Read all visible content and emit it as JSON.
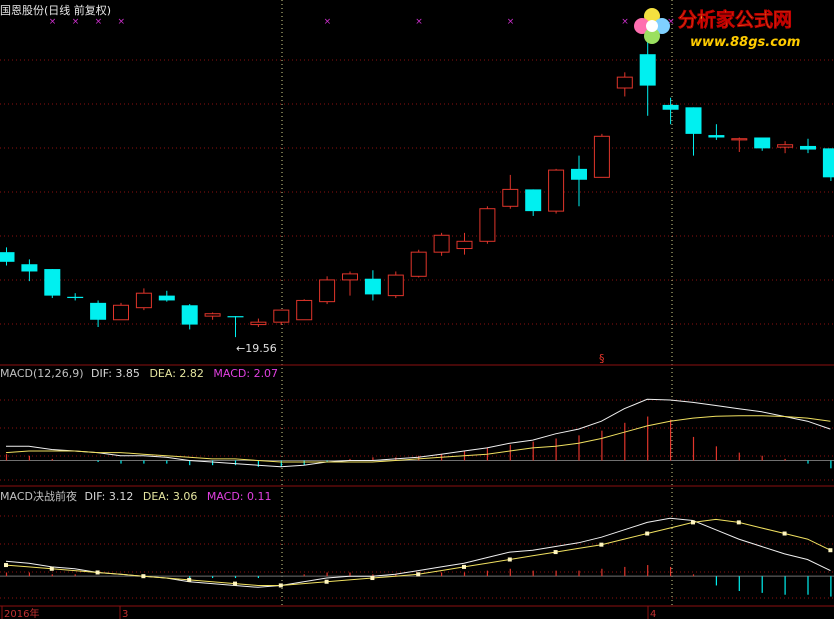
{
  "header": {
    "stock_title": "国恩股份(日线 前复权)"
  },
  "logo": {
    "text1": "分析家公式网",
    "text2": "www.88gs.com"
  },
  "colors": {
    "up": "#e0352b",
    "down": "#00f0f0",
    "dif_line": "#f0f0f0",
    "dea_line": "#f0e060",
    "macd_mag": "#e040e0",
    "grid_dot": "#8b1010",
    "divider": "#8b1010",
    "marker": "#d030d0"
  },
  "price_panel": {
    "low_label": "←19.56",
    "top_markers": [
      "×",
      "×",
      "×",
      "×",
      "×",
      "×",
      "×",
      "×",
      "×"
    ],
    "s_marker": "§"
  },
  "macd1": {
    "name": "MACD(12,26,9)",
    "dif_label": "DIF: 3.85",
    "dea_label": "DEA: 2.82",
    "macd_label": "MACD: 2.07"
  },
  "macd2": {
    "name": "MACD决战前夜",
    "dif_label": "DIF: 3.12",
    "dea_label": "DEA: 3.06",
    "macd_label": "MACD: 0.11"
  },
  "axis": {
    "date_labels": [
      "2016年",
      "3",
      "4"
    ]
  },
  "chart_data": [
    {
      "type": "candlestick",
      "title": "国恩股份(日线 前复权)",
      "candles": [
        {
          "o": 26.6,
          "h": 27.0,
          "l": 25.5,
          "c": 25.8
        },
        {
          "o": 25.6,
          "h": 26.0,
          "l": 24.2,
          "c": 25.0
        },
        {
          "o": 25.2,
          "h": 25.2,
          "l": 22.8,
          "c": 23.0
        },
        {
          "o": 22.9,
          "h": 23.2,
          "l": 22.6,
          "c": 22.8
        },
        {
          "o": 22.4,
          "h": 22.6,
          "l": 20.4,
          "c": 21.0
        },
        {
          "o": 21.0,
          "h": 22.4,
          "l": 21.0,
          "c": 22.2
        },
        {
          "o": 22.0,
          "h": 23.6,
          "l": 21.8,
          "c": 23.2
        },
        {
          "o": 23.0,
          "h": 23.4,
          "l": 22.5,
          "c": 22.6
        },
        {
          "o": 22.2,
          "h": 22.3,
          "l": 20.2,
          "c": 20.6
        },
        {
          "o": 21.3,
          "h": 21.6,
          "l": 21.0,
          "c": 21.5
        },
        {
          "o": 21.3,
          "h": 21.3,
          "l": 19.56,
          "c": 21.2
        },
        {
          "o": 20.6,
          "h": 21.1,
          "l": 20.4,
          "c": 20.8
        },
        {
          "o": 20.8,
          "h": 21.8,
          "l": 20.6,
          "c": 21.8
        },
        {
          "o": 21.0,
          "h": 22.7,
          "l": 21.0,
          "c": 22.6
        },
        {
          "o": 22.5,
          "h": 24.6,
          "l": 22.3,
          "c": 24.3
        },
        {
          "o": 24.3,
          "h": 25.0,
          "l": 23.0,
          "c": 24.8
        },
        {
          "o": 24.4,
          "h": 25.1,
          "l": 22.6,
          "c": 23.1
        },
        {
          "o": 23.0,
          "h": 25.0,
          "l": 22.8,
          "c": 24.7
        },
        {
          "o": 24.6,
          "h": 26.8,
          "l": 24.5,
          "c": 26.6
        },
        {
          "o": 26.6,
          "h": 28.2,
          "l": 26.3,
          "c": 28.0
        },
        {
          "o": 26.9,
          "h": 28.2,
          "l": 26.4,
          "c": 27.5
        },
        {
          "o": 27.5,
          "h": 30.4,
          "l": 27.3,
          "c": 30.2
        },
        {
          "o": 30.4,
          "h": 33.0,
          "l": 30.2,
          "c": 31.8
        },
        {
          "o": 31.8,
          "h": 31.8,
          "l": 29.6,
          "c": 30.0
        },
        {
          "o": 30.0,
          "h": 33.5,
          "l": 29.8,
          "c": 33.4
        },
        {
          "o": 33.5,
          "h": 34.6,
          "l": 30.4,
          "c": 32.6
        },
        {
          "o": 32.8,
          "h": 36.4,
          "l": 32.8,
          "c": 36.2
        },
        {
          "o": 40.2,
          "h": 41.5,
          "l": 39.5,
          "c": 41.1
        },
        {
          "o": 43.0,
          "h": 44.4,
          "l": 37.9,
          "c": 40.4
        },
        {
          "o": 38.8,
          "h": 39.4,
          "l": 37.2,
          "c": 38.4
        },
        {
          "o": 38.6,
          "h": 38.6,
          "l": 34.6,
          "c": 36.4
        },
        {
          "o": 36.3,
          "h": 37.2,
          "l": 35.9,
          "c": 36.1
        },
        {
          "o": 35.9,
          "h": 36.1,
          "l": 34.9,
          "c": 36.0
        },
        {
          "o": 36.1,
          "h": 36.1,
          "l": 35.0,
          "c": 35.2
        },
        {
          "o": 35.3,
          "h": 35.8,
          "l": 34.8,
          "c": 35.5
        },
        {
          "o": 35.4,
          "h": 36.0,
          "l": 34.8,
          "c": 35.1
        },
        {
          "o": 35.2,
          "h": 35.2,
          "l": 32.5,
          "c": 32.8
        }
      ],
      "ylim": [
        17.5,
        46.0
      ],
      "annotations": [
        "←19.56"
      ]
    },
    {
      "type": "line",
      "title": "MACD(12,26,9)",
      "series": [
        {
          "name": "DIF",
          "values": [
            0.9,
            0.9,
            0.7,
            0.6,
            0.5,
            0.3,
            0.3,
            0.2,
            0.0,
            -0.1,
            -0.2,
            -0.3,
            -0.4,
            -0.3,
            -0.1,
            0.0,
            0.0,
            0.1,
            0.2,
            0.4,
            0.6,
            0.8,
            1.1,
            1.3,
            1.7,
            2.0,
            2.5,
            3.3,
            3.9,
            3.85,
            3.7,
            3.5,
            3.3,
            3.1,
            2.8,
            2.5,
            2.0
          ]
        },
        {
          "name": "DEA",
          "values": [
            0.5,
            0.6,
            0.6,
            0.6,
            0.5,
            0.5,
            0.4,
            0.3,
            0.2,
            0.1,
            0.1,
            0.0,
            -0.1,
            -0.1,
            -0.1,
            -0.1,
            -0.1,
            0.0,
            0.1,
            0.2,
            0.3,
            0.4,
            0.6,
            0.8,
            0.9,
            1.1,
            1.4,
            1.8,
            2.2,
            2.5,
            2.7,
            2.82,
            2.85,
            2.85,
            2.8,
            2.7,
            2.5
          ]
        }
      ],
      "histogram": [
        0.4,
        0.3,
        0.1,
        0.0,
        -0.1,
        -0.2,
        -0.2,
        -0.2,
        -0.3,
        -0.3,
        -0.3,
        -0.4,
        -0.4,
        -0.3,
        -0.1,
        0.1,
        0.2,
        0.2,
        0.3,
        0.4,
        0.6,
        0.8,
        1.0,
        1.2,
        1.4,
        1.6,
        1.9,
        2.4,
        2.8,
        2.6,
        1.5,
        0.9,
        0.5,
        0.3,
        0.1,
        -0.2,
        -0.5
      ],
      "ylim": [
        -1.5,
        5.0
      ]
    },
    {
      "type": "line",
      "title": "MACD决战前夜",
      "series": [
        {
          "name": "DIF",
          "values": [
            0.8,
            0.7,
            0.5,
            0.4,
            0.2,
            0.1,
            0.0,
            -0.1,
            -0.3,
            -0.4,
            -0.5,
            -0.6,
            -0.5,
            -0.3,
            -0.1,
            0.0,
            0.0,
            0.1,
            0.3,
            0.5,
            0.7,
            1.0,
            1.3,
            1.4,
            1.6,
            1.8,
            2.1,
            2.5,
            2.9,
            3.12,
            3.0,
            2.5,
            2.0,
            1.6,
            1.2,
            0.9,
            0.3
          ]
        },
        {
          "name": "DEA",
          "values": [
            0.6,
            0.5,
            0.4,
            0.3,
            0.2,
            0.1,
            0.0,
            -0.1,
            -0.2,
            -0.3,
            -0.4,
            -0.5,
            -0.5,
            -0.4,
            -0.3,
            -0.2,
            -0.1,
            0.0,
            0.1,
            0.3,
            0.5,
            0.7,
            0.9,
            1.1,
            1.3,
            1.5,
            1.7,
            2.0,
            2.3,
            2.6,
            2.9,
            3.06,
            2.9,
            2.6,
            2.3,
            2.0,
            1.4
          ]
        }
      ],
      "histogram": [
        0.2,
        0.2,
        0.1,
        0.1,
        0.0,
        0.0,
        0.0,
        0.0,
        -0.1,
        -0.1,
        -0.1,
        -0.1,
        0.0,
        0.1,
        0.2,
        0.2,
        0.1,
        0.1,
        0.2,
        0.2,
        0.2,
        0.3,
        0.4,
        0.3,
        0.3,
        0.3,
        0.4,
        0.5,
        0.6,
        0.5,
        0.1,
        -0.5,
        -0.8,
        -0.9,
        -1.0,
        -1.0,
        -1.1
      ],
      "ylim": [
        -1.5,
        4.0
      ]
    }
  ]
}
